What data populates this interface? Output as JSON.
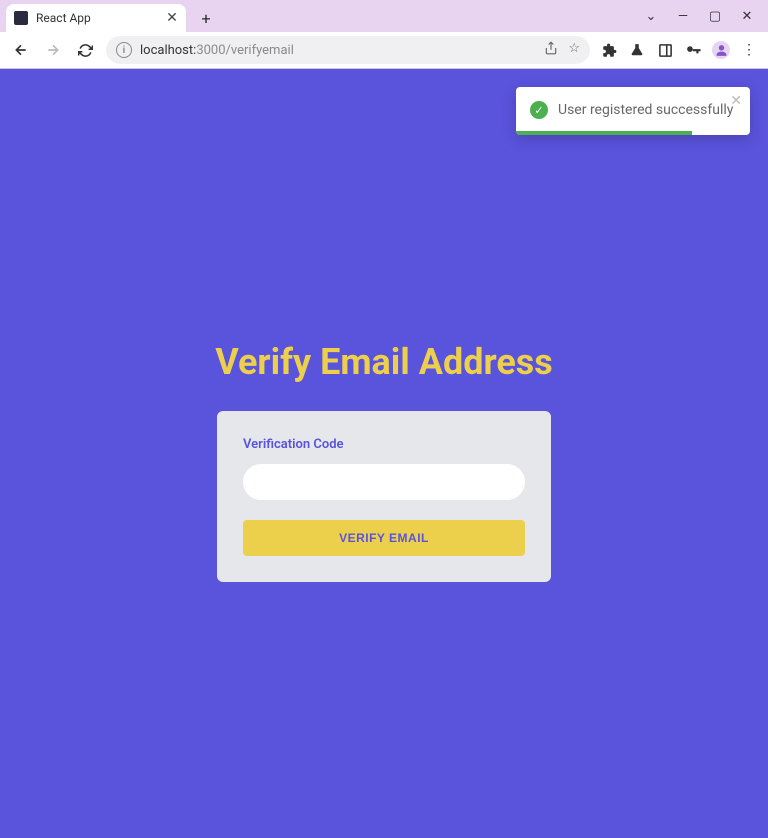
{
  "browser": {
    "tab_title": "React App",
    "url_host": "localhost:",
    "url_port_path": "3000/verifyemail"
  },
  "toast": {
    "message": "User registered successfully"
  },
  "page": {
    "heading": "Verify Email Address",
    "form": {
      "code_label": "Verification Code",
      "code_value": "",
      "submit_label": "VERIFY EMAIL"
    }
  },
  "colors": {
    "primary_bg": "#5a53dc",
    "accent": "#ecd04b",
    "success": "#4caf50"
  }
}
